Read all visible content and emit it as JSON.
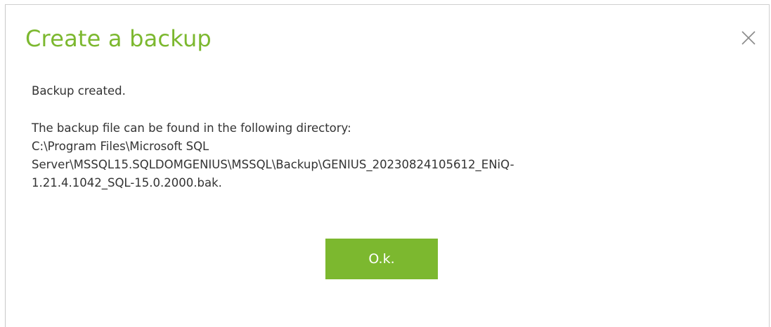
{
  "dialog": {
    "title": "Create a backup",
    "close_icon": "close-icon",
    "message": "Backup created.",
    "directory_intro": "The backup file can be found in the following directory:",
    "path_line_1": "C:\\Program Files\\Microsoft SQL",
    "path_line_2": "Server\\MSSQL15.SQLDOMGENIUS\\MSSQL\\Backup\\GENIUS_20230824105612_ENiQ-",
    "path_line_3": "1.21.4.1042_SQL-15.0.2000.bak.",
    "ok_label": "O.k."
  },
  "colors": {
    "accent": "#7cb82f",
    "text": "#333333",
    "close_icon": "#8a8a8a",
    "border": "#d0d0d0"
  }
}
